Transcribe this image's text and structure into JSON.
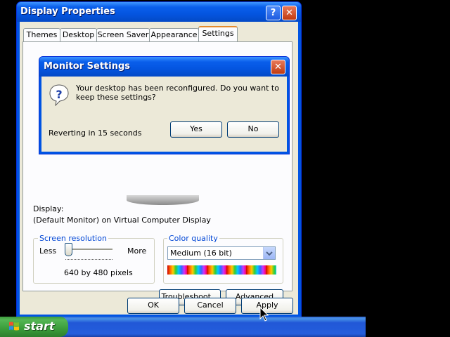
{
  "window": {
    "title": "Display Properties",
    "help_label": "?",
    "close_label": "✕"
  },
  "tabs": [
    {
      "label": "Themes"
    },
    {
      "label": "Desktop"
    },
    {
      "label": "Screen Saver"
    },
    {
      "label": "Appearance"
    },
    {
      "label": "Settings",
      "active": true
    }
  ],
  "display": {
    "label": "Display:",
    "value": "(Default Monitor) on Virtual Computer Display"
  },
  "resolution": {
    "group_label": "Screen resolution",
    "less": "Less",
    "more": "More",
    "value": "640 by 480 pixels",
    "slider_level": 0
  },
  "color_quality": {
    "group_label": "Color quality",
    "selected": "Medium (16 bit)"
  },
  "buttons": {
    "troubleshoot": "Troubleshoot...",
    "advanced": "Advanced",
    "ok": "OK",
    "cancel": "Cancel",
    "apply": "Apply"
  },
  "dialog": {
    "title": "Monitor Settings",
    "message": "Your desktop has been reconfigured.  Do you want to keep these settings?",
    "countdown": "Reverting in 15 seconds",
    "yes": "Yes",
    "no": "No",
    "close_label": "✕"
  },
  "taskbar": {
    "start_label": "start"
  },
  "colors": {
    "title_blue": "#0054E3",
    "face": "#ECE9D8",
    "close_red": "#C13A10",
    "start_green": "#3A9C3A"
  }
}
